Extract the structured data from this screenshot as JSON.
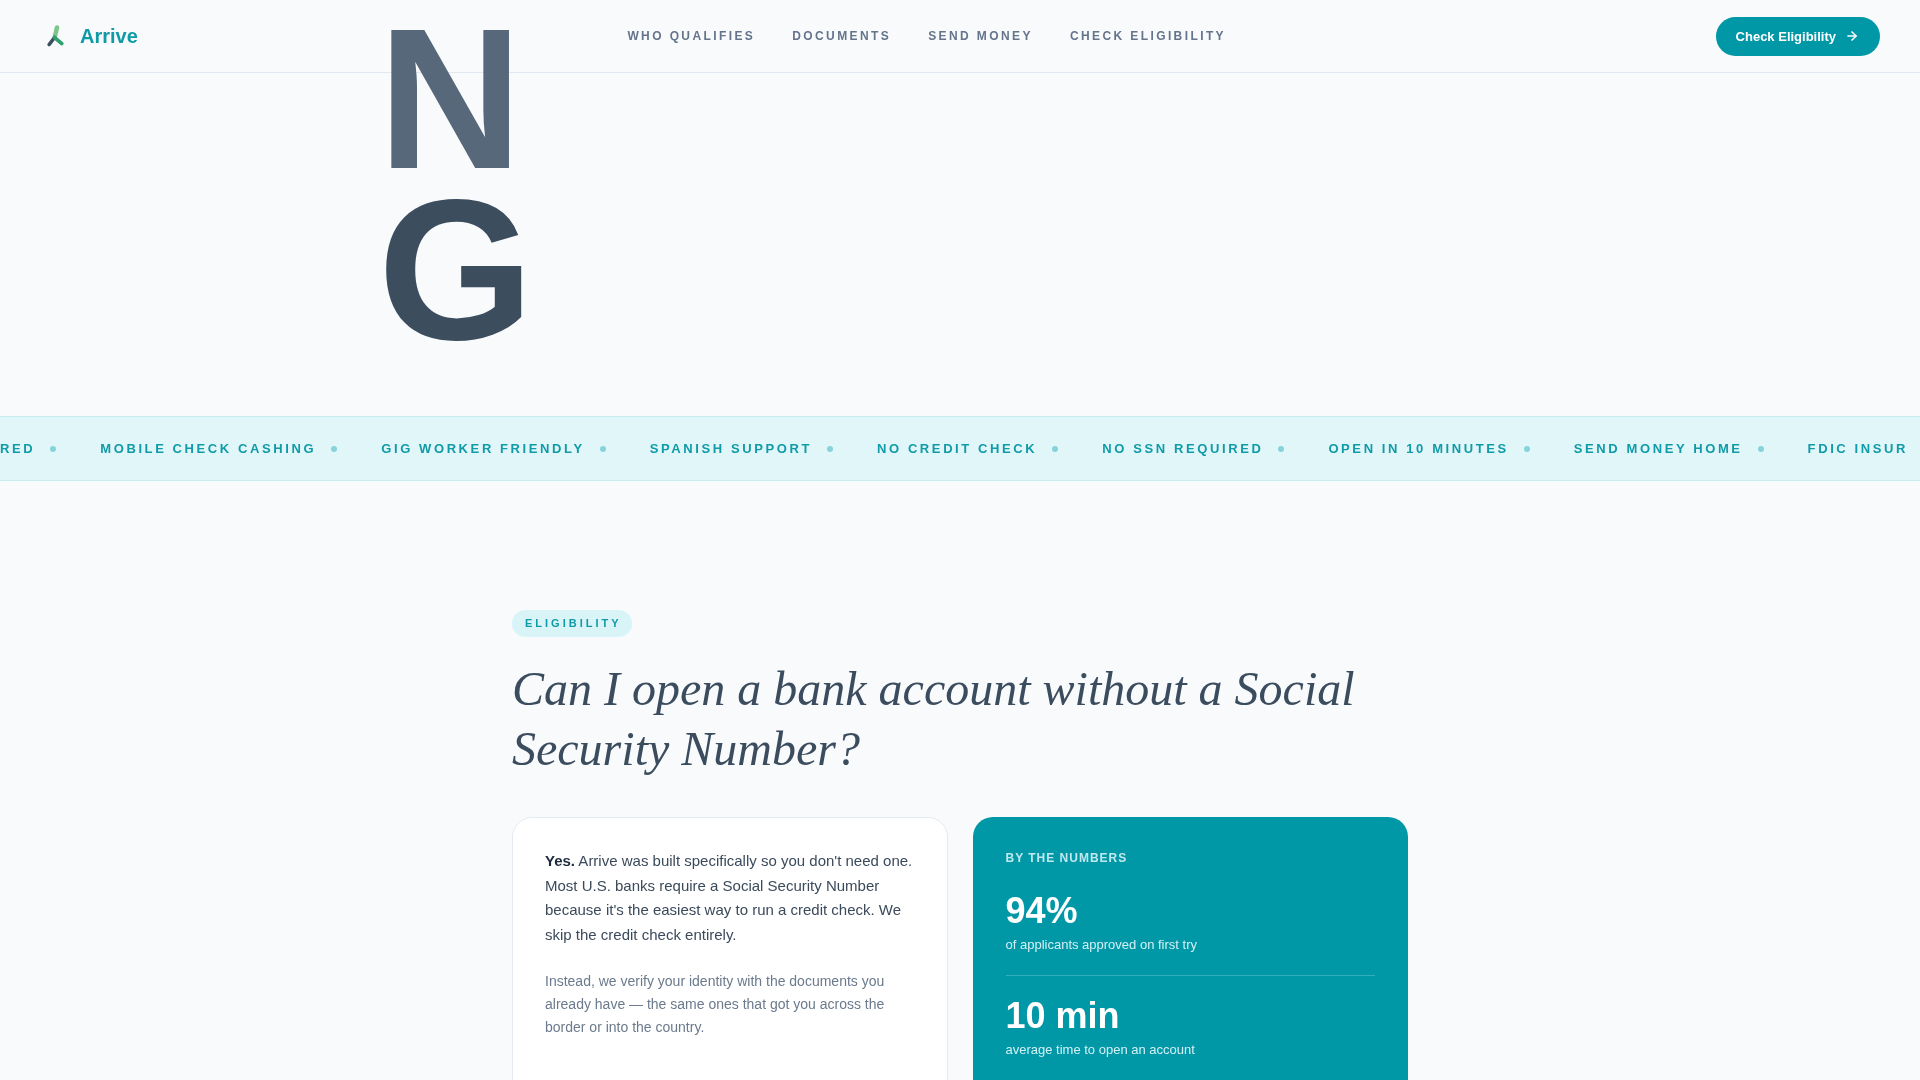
{
  "header": {
    "logo": {
      "name": "Arrive"
    },
    "nav": [
      {
        "label": "WHO QUALIFIES"
      },
      {
        "label": "DOCUMENTS"
      },
      {
        "label": "SEND MONEY"
      },
      {
        "label": "CHECK ELIGIBILITY"
      }
    ],
    "cta": {
      "label": "Check Eligibility"
    }
  },
  "hero": {
    "letters": [
      {
        "char": "N",
        "color": "#566879"
      },
      {
        "char": "G",
        "color": "#3c4d5e"
      }
    ]
  },
  "ticker": {
    "items": [
      "RED",
      "MOBILE CHECK CASHING",
      "GIG WORKER FRIENDLY",
      "SPANISH SUPPORT",
      "NO CREDIT CHECK",
      "NO SSN REQUIRED",
      "OPEN IN 10 MINUTES",
      "SEND MONEY HOME",
      "FDIC INSUR"
    ]
  },
  "eligibility": {
    "tag": "ELIGIBILITY",
    "heading": "Can I open a bank account without a Social Security Number?",
    "answer_card": {
      "paragraphs": [
        {
          "kind": "lead",
          "text": "**Yes.** Arrive was built specifically so you don't need one. Most U.S. banks require a Social Security Number because it's the easiest way to run a credit check. We skip the credit check entirely."
        },
        {
          "kind": "note",
          "text": "Instead, we verify your identity with the documents you already have — the same ones that got you across the border or into the country."
        }
      ]
    },
    "stats_card": {
      "title": "BY THE NUMBERS",
      "stats": [
        {
          "value": "94%",
          "caption": "of applicants approved on first try"
        },
        {
          "value": "10 min",
          "caption": "average time to open an account"
        }
      ]
    }
  }
}
